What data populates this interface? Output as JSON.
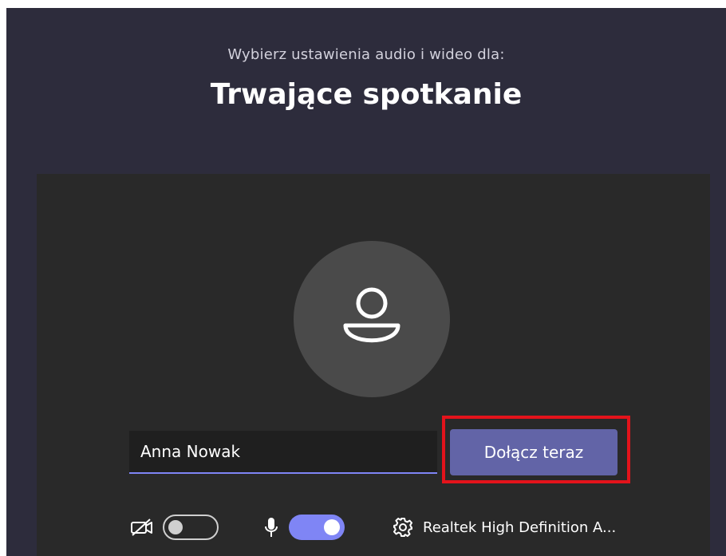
{
  "header": {
    "subtitle": "Wybierz ustawienia audio i wideo dla:",
    "meeting_title": "Trwające spotkanie"
  },
  "prejoin": {
    "name_value": "Anna Nowak",
    "join_label": "Dołącz teraz",
    "camera": {
      "icon": "camera-off-icon",
      "enabled": false
    },
    "microphone": {
      "icon": "microphone-icon",
      "enabled": true
    },
    "device": {
      "icon": "gear-icon",
      "label": "Realtek High Definition A..."
    }
  },
  "colors": {
    "background": "#2d2c3c",
    "preview": "#292929",
    "accent": "#6264a7",
    "toggle_on": "#7f85f5",
    "highlight": "#e3131b"
  }
}
